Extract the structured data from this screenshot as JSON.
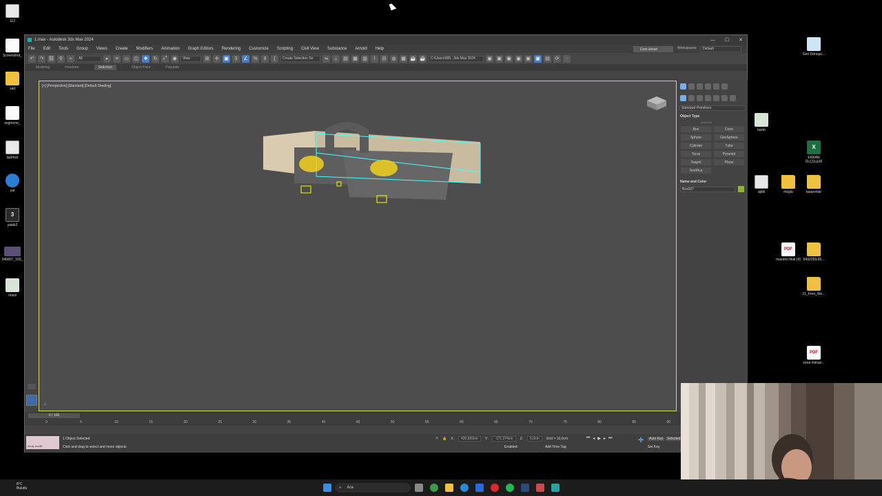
{
  "desktop_left": [
    {
      "label": "112",
      "kind": "max"
    },
    {
      "label": "Screenshot_",
      "kind": "doc"
    },
    {
      "label": "sad",
      "kind": "folder"
    },
    {
      "label": "segmono_",
      "kind": "doc"
    },
    {
      "label": "lazimss",
      "kind": "max"
    },
    {
      "label": "yat",
      "kind": "blue"
    },
    {
      "label": "yatak2",
      "kind": "max3",
      "glyph": "3"
    },
    {
      "label": "045807_150_",
      "kind": "thumb"
    },
    {
      "label": "masii",
      "kind": "thumb2"
    }
  ],
  "desktop_right": [
    {
      "label": "Geri Dönüşü...",
      "kind": "bin"
    },
    {
      "label": "lazim",
      "kind": "thumb2"
    },
    {
      "label": "EKRAN ÖLÇÜLERİ",
      "kind": "xls",
      "glyph": "X"
    },
    {
      "label": "aplik",
      "kind": "max"
    },
    {
      "label": "müştü",
      "kind": "folder"
    },
    {
      "label": "tasarımlar",
      "kind": "folder"
    },
    {
      "label": "masımo final (4)",
      "kind": "pdf",
      "glyph": "PDF"
    },
    {
      "label": "6432269.66...",
      "kind": "folder"
    },
    {
      "label": "21_Free_We...",
      "kind": "folder"
    },
    {
      "label": "sona mimari...",
      "kind": "pdf",
      "glyph": "PDF"
    }
  ],
  "window": {
    "title": "1.max - Autodesk 3ds Max 2024",
    "controls": [
      "—",
      "☐",
      "✕"
    ]
  },
  "menu": [
    "File",
    "Edit",
    "Tools",
    "Group",
    "Views",
    "Create",
    "Modifiers",
    "Animation",
    "Graph Editors",
    "Rendering",
    "Customize",
    "Scripting",
    "Civil View",
    "Substance",
    "Arnold",
    "Help"
  ],
  "user": "Cem isman",
  "workspaces": {
    "label": "Workspaces:",
    "value": "Default"
  },
  "toolbar": {
    "filter": "All",
    "view": "View",
    "selection_set": "Create Selection Se",
    "path": "C:\\Users\\905...3ds Max 2024"
  },
  "ribbon": [
    "Modeling",
    "Freeform",
    "Selection",
    "Object Paint",
    "Populate"
  ],
  "viewport": {
    "label": "[+] [Perspective] [Standard] [Default Shading]"
  },
  "command_panel": {
    "category": "Standard Primitives",
    "object_type_title": "Object Type",
    "autogrid": "AutoGrid",
    "primitives": [
      "Box",
      "Cone",
      "Sphere",
      "GeoSphere",
      "Cylinder",
      "Tube",
      "Torus",
      "Pyramid",
      "Teapot",
      "Plane",
      "TextPlus"
    ],
    "name_color_title": "Name and Color",
    "object_name": "Box007",
    "object_color": "#8fb830"
  },
  "timeline": {
    "frame": "0 / 100",
    "ticks": [
      "0",
      "5",
      "10",
      "15",
      "20",
      "25",
      "30",
      "35",
      "40",
      "45",
      "50",
      "55",
      "60",
      "65",
      "70",
      "75",
      "80",
      "85",
      "90"
    ]
  },
  "status": {
    "script": "Array modifi",
    "selected": "1 Object Selected",
    "prompt": "Click and drag to select and move objects",
    "x": "430,833cm",
    "y": "-171,274cm",
    "z": "5,0cm",
    "grid": "Grid = 10,0cm",
    "enabled": "Enabled:",
    "add_time_tag": "Add Time Tag",
    "auto_key": "Auto Key",
    "selected_label": "Selected",
    "set_key": "Set Key"
  },
  "taskbar": {
    "search": "Ara",
    "weather_temp": "8°C",
    "weather_text": "Bulutlu"
  }
}
